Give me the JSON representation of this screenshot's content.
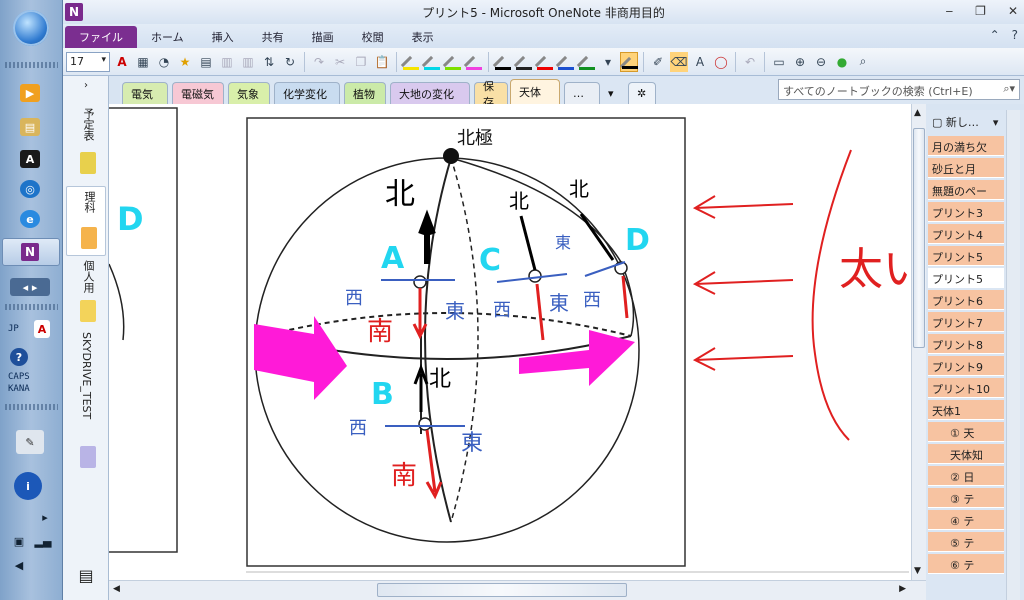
{
  "window": {
    "title": "プリント5 - Microsoft OneNote 非商用目的",
    "app_logo": "N",
    "controls": [
      "‒",
      "❐",
      "✕"
    ]
  },
  "ribbon": {
    "tabs": [
      "ファイル",
      "ホーム",
      "挿入",
      "共有",
      "描画",
      "校閲",
      "表示"
    ],
    "help": "?",
    "collapse": "⌃"
  },
  "toolbar": {
    "font_size": "17"
  },
  "sections": {
    "tabs": [
      "電気",
      "電磁気",
      "気象",
      "化学変化",
      "植物",
      "大地の変化",
      "保存",
      "天体",
      "…"
    ],
    "active": "天体",
    "colors": [
      "#d7ecb0",
      "#f7c8d4",
      "#d9efaa",
      "#c9dcf0",
      "#cbeaa8",
      "#d9c9ee",
      "#f9e0a6",
      "#fff4e0",
      "#e9eef5"
    ],
    "search_placeholder": "すべてのノートブックの検索 (Ctrl+E)"
  },
  "notebooks": [
    {
      "label": "予定表",
      "color": "#e8d04c"
    },
    {
      "label": "理科",
      "color": "#f5b34c"
    },
    {
      "label": "個人用",
      "color": "#f3d35a"
    },
    {
      "label": "SKYDRIVE_TEST",
      "color": "#b9b4e6"
    }
  ],
  "pages": {
    "new_label": "新し…",
    "items": [
      {
        "label": "月の満ち欠",
        "sub": false
      },
      {
        "label": "砂丘と月",
        "sub": false
      },
      {
        "label": "無題のペー",
        "sub": false
      },
      {
        "label": "プリント3",
        "sub": false
      },
      {
        "label": "プリント4",
        "sub": false
      },
      {
        "label": "プリント5",
        "sub": false
      },
      {
        "label": "プリント5",
        "sub": false,
        "selected": true
      },
      {
        "label": "プリント6",
        "sub": false
      },
      {
        "label": "プリント7",
        "sub": false
      },
      {
        "label": "プリント8",
        "sub": false
      },
      {
        "label": "プリント9",
        "sub": false
      },
      {
        "label": "プリント10",
        "sub": false
      },
      {
        "label": "天体1",
        "sub": false
      },
      {
        "label": "① 天",
        "sub": true
      },
      {
        "label": "天体知",
        "sub": true
      },
      {
        "label": "② 日",
        "sub": true
      },
      {
        "label": "③ テ",
        "sub": true
      },
      {
        "label": "④ テ",
        "sub": true
      },
      {
        "label": "⑤ テ",
        "sub": true
      },
      {
        "label": "⑥ テ",
        "sub": true
      }
    ]
  },
  "taskbar": {
    "tray": {
      "lang": "JP",
      "caps": "CAPS",
      "kana": "KANA"
    }
  },
  "diagram": {
    "north_pole": "北極",
    "points": [
      "A",
      "B",
      "C",
      "D",
      "D"
    ],
    "north": "北",
    "south": "南",
    "west": "西",
    "east": "東",
    "annotation": "太い",
    "label_colors": {
      "cyan": "#22d6f0",
      "blue": "#3a5fc0",
      "red": "#e02020",
      "magenta": "#ff1ad8"
    }
  }
}
